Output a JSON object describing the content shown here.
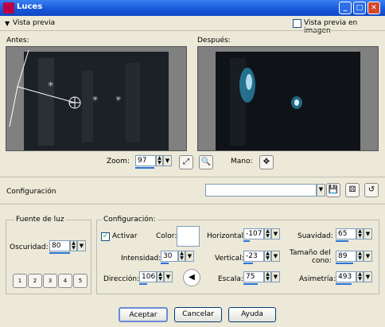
{
  "window": {
    "title": "Luces"
  },
  "preview": {
    "toggle_label": "Vista previa",
    "image_preview_label": "Vista previa en imagen",
    "before_label": "Antes:",
    "after_label": "Después:"
  },
  "zoom": {
    "label": "Zoom:",
    "value": "97"
  },
  "hand": {
    "label": "Mano:"
  },
  "config_row": {
    "label": "Configuración",
    "preset_value": ""
  },
  "light_source": {
    "title": "Fuente de luz",
    "darkness_label": "Oscuridad:",
    "darkness_value": "80",
    "light_buttons": [
      "1",
      "2",
      "3",
      "4",
      "5"
    ]
  },
  "settings": {
    "title": "Configuración:",
    "activate_label": "Activar",
    "activate_checked": true,
    "color_label": "Color:",
    "color_value": "#ffffff",
    "intensity_label": "Intensidad:",
    "intensity_value": "30",
    "direction_label": "Dirección:",
    "direction_value": "106",
    "horizontal_label": "Horizontal:",
    "horizontal_value": "-107",
    "vertical_label": "Vertical:",
    "vertical_value": "-23",
    "scale_label": "Escala:",
    "scale_value": "75",
    "smoothness_label": "Suavidad:",
    "smoothness_value": "65",
    "cone_label_line1": "Tamaño del",
    "cone_label_line2": "cono:",
    "cone_value": "89",
    "asymmetry_label": "Asimetría:",
    "asymmetry_value": "493"
  },
  "footer": {
    "accept_label": "Aceptar",
    "cancel_label": "Cancelar",
    "help_label": "Ayuda"
  }
}
